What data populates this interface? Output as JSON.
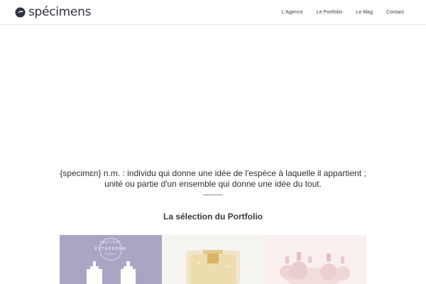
{
  "brand": {
    "name": "spécimens",
    "logo_icon": "specimens-logo-mark",
    "color": "#2f3440"
  },
  "nav": {
    "items": [
      {
        "label": "L'Agence",
        "name": "nav-item-agence"
      },
      {
        "label": "Le Portfolio",
        "name": "nav-item-portfolio"
      },
      {
        "label": "Le Mag",
        "name": "nav-item-mag"
      },
      {
        "label": "Contact",
        "name": "nav-item-contact"
      }
    ]
  },
  "tagline": {
    "line1": "{specimɛn} n.m. : individu qui donne une idée de l'espèce à laquelle il appartient ;",
    "line2": "unité ou partie d'un ensemble qui donne une idée du tout."
  },
  "portfolio": {
    "title": "La sélection du Portfolio",
    "tiles": [
      {
        "brand_top": "INSTITUT",
        "brand_main": "ESTHEDERM",
        "brand_sub": "PARIS",
        "background": "#a9a6c4"
      },
      {
        "background": "#f6f4f0"
      },
      {
        "background": "#f9efef"
      }
    ]
  }
}
